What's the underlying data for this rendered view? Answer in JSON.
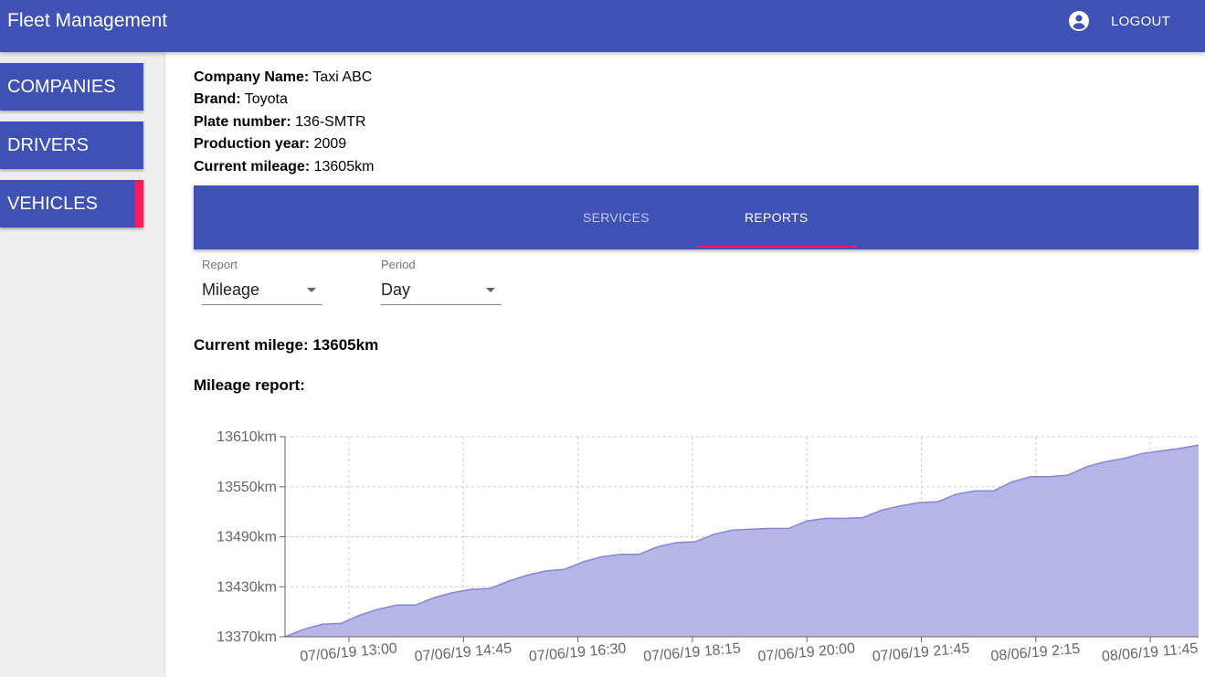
{
  "app": {
    "title": "Fleet Management",
    "logout_label": "LOGOUT"
  },
  "sidebar": {
    "items": [
      {
        "label": "COMPANIES"
      },
      {
        "label": "DRIVERS"
      },
      {
        "label": "VEHICLES",
        "active": true
      }
    ]
  },
  "vehicle": {
    "company_name_label": "Company Name:",
    "company_name": "Taxi ABC",
    "brand_label": "Brand:",
    "brand": "Toyota",
    "plate_label": "Plate number:",
    "plate": "136-SMTR",
    "year_label": "Production year:",
    "year": "2009",
    "mileage_label": "Current mileage:",
    "mileage": "13605km"
  },
  "tabs": [
    {
      "label": "SERVICES"
    },
    {
      "label": "REPORTS",
      "active": true
    }
  ],
  "filters": {
    "report_label": "Report",
    "report_value": "Mileage",
    "period_label": "Period",
    "period_value": "Day"
  },
  "current_mileage_text": "Current milege: 13605km",
  "report_heading": "Mileage report:",
  "colors": {
    "primary": "#3f51b5",
    "accent": "#ff1a5e",
    "area_fill": "#b7b5e8",
    "area_stroke": "#8884d8"
  },
  "chart_data": {
    "type": "area",
    "ylim": [
      13370,
      13610
    ],
    "y_ticks": [
      "13610km",
      "13550km",
      "13490km",
      "13430km",
      "13370km"
    ],
    "y_tick_values": [
      13610,
      13550,
      13490,
      13430,
      13370
    ],
    "x_ticks": [
      "07/06/19 13:00",
      "07/06/19 14:45",
      "07/06/19 16:30",
      "07/06/19 18:15",
      "07/06/19 20:00",
      "07/06/19 21:45",
      "08/06/19 2:15",
      "08/06/19 11:45"
    ],
    "grid": true,
    "values": [
      13370,
      13379,
      13385,
      13386,
      13396,
      13403,
      13408,
      13408,
      13417,
      13423,
      13427,
      13428,
      13437,
      13444,
      13449,
      13451,
      13460,
      13466,
      13469,
      13469,
      13478,
      13483,
      13484,
      13493,
      13498,
      13499,
      13500,
      13500,
      13509,
      13512,
      13512,
      13513,
      13522,
      13527,
      13531,
      13532,
      13541,
      13545,
      13545,
      13556,
      13562,
      13562,
      13564,
      13574,
      13580,
      13584,
      13590,
      13593,
      13596,
      13600
    ]
  }
}
